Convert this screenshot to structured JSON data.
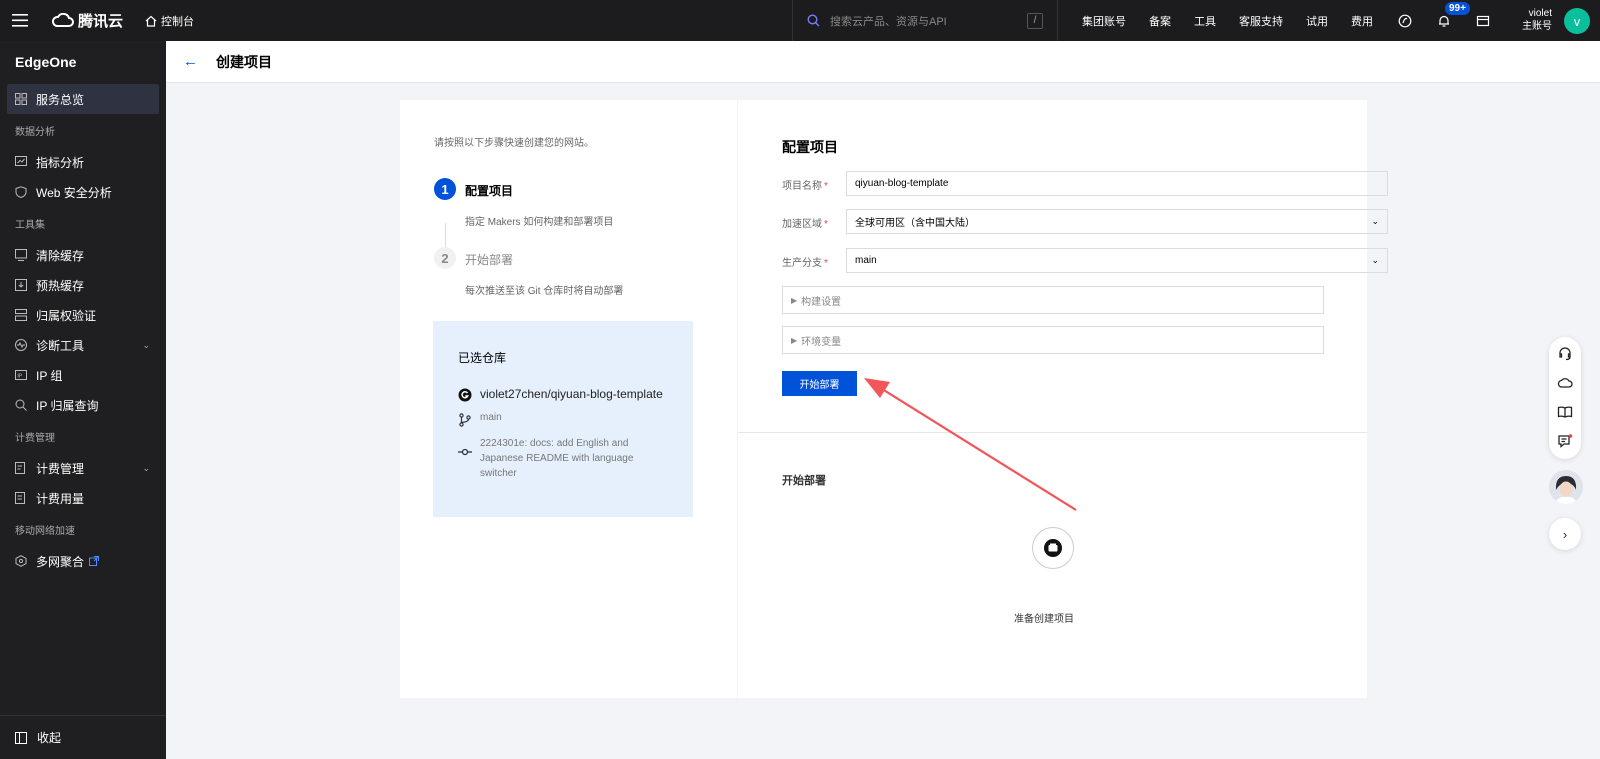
{
  "topbar": {
    "brand": "腾讯云",
    "console_label": "控制台",
    "search_placeholder": "搜索云产品、资源与API",
    "search_shortcut": "/",
    "nav": [
      "集团账号",
      "备案",
      "工具",
      "客服支持",
      "试用",
      "费用"
    ],
    "notification_badge": "99+",
    "user_name": "violet",
    "user_role": "主账号",
    "avatar_letter": "v"
  },
  "sidebar": {
    "title": "EdgeOne",
    "overview": "服务总览",
    "groups": [
      {
        "label": "数据分析",
        "items": [
          "指标分析",
          "Web 安全分析"
        ]
      },
      {
        "label": "工具集",
        "items": [
          "清除缓存",
          "预热缓存",
          "归属权验证",
          "诊断工具",
          "IP 组",
          "IP 归属查询"
        ]
      },
      {
        "label": "计费管理",
        "items": [
          "计费管理",
          "计费用量"
        ]
      },
      {
        "label": "移动网络加速",
        "items": [
          "多网聚合"
        ]
      }
    ],
    "collapse_label": "收起"
  },
  "page": {
    "title": "创建项目"
  },
  "steps_panel": {
    "intro": "请按照以下步骤快速创建您的网站。",
    "steps": [
      {
        "num": "1",
        "title": "配置项目",
        "desc": "指定 Makers 如何构建和部署项目"
      },
      {
        "num": "2",
        "title": "开始部署",
        "desc": "每次推送至该 Git 仓库时将自动部署"
      }
    ],
    "repo": {
      "title": "已选仓库",
      "name": "violet27chen/qiyuan-blog-template",
      "branch": "main",
      "commit": "2224301e: docs: add English and Japanese README with language switcher"
    }
  },
  "config_panel": {
    "title": "配置项目",
    "fields": [
      {
        "label": "项目名称",
        "value": "qiyuan-blog-template"
      },
      {
        "label": "加速区域",
        "value": "全球可用区（含中国大陆）"
      },
      {
        "label": "生产分支",
        "value": "main"
      }
    ],
    "build_settings": "构建设置",
    "env_vars": "环境变量",
    "deploy_button": "开始部署",
    "deploy_section_title": "开始部署",
    "prepare_text": "准备创建项目"
  },
  "colors": {
    "primary": "#0052d9",
    "required": "#e54545",
    "annotation_arrow": "#f0565a",
    "sidebar_bg": "#1f1f21",
    "topbar_bg": "#1c1c1e"
  }
}
